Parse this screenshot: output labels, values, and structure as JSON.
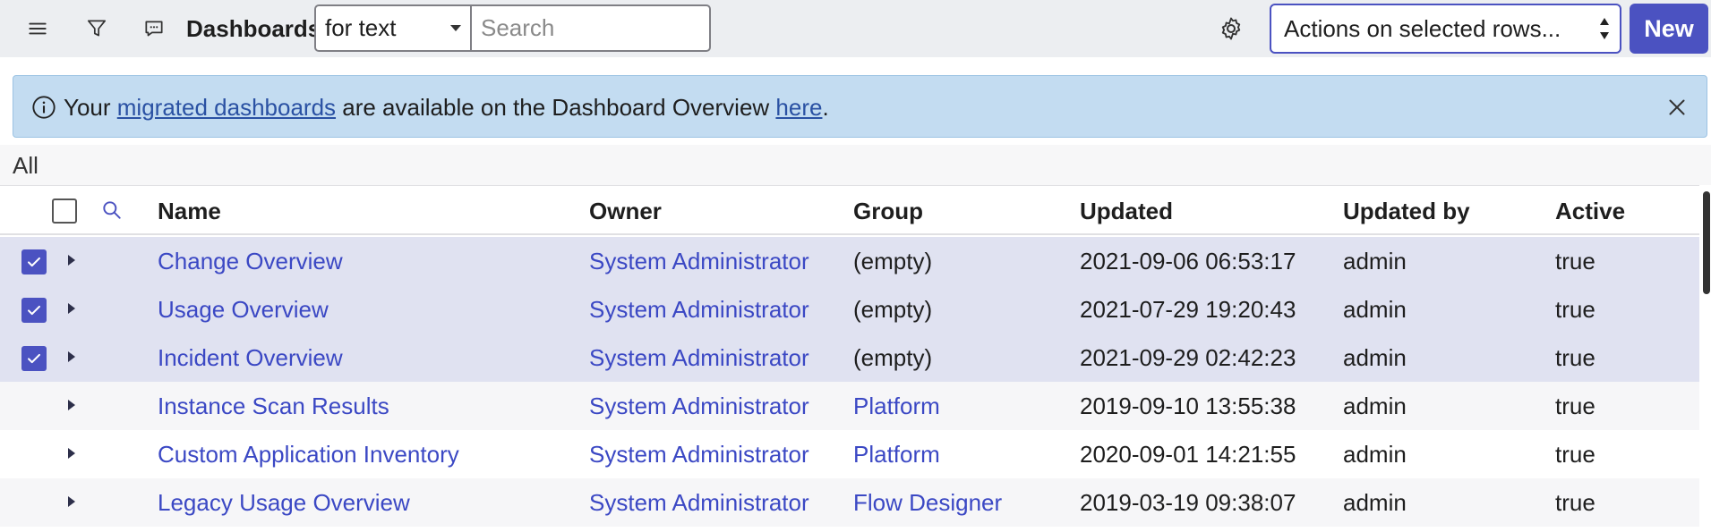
{
  "header": {
    "title": "Dashboards",
    "search_field_select": "for text",
    "search_placeholder": "Search",
    "actions_select": "Actions on selected rows...",
    "new_button": "New"
  },
  "banner": {
    "text_before": "Your ",
    "link1": "migrated dashboards",
    "text_middle": " are available on the Dashboard Overview ",
    "link2": "here",
    "text_after": "."
  },
  "breadcrumb": "All",
  "table": {
    "columns": [
      "Name",
      "Owner",
      "Group",
      "Updated",
      "Updated by",
      "Active"
    ],
    "rows": [
      {
        "selected": true,
        "name": "Change Overview",
        "owner": "System Administrator",
        "group": "(empty)",
        "group_link": false,
        "updated": "2021-09-06 06:53:17",
        "updated_by": "admin",
        "active": "true"
      },
      {
        "selected": true,
        "name": "Usage Overview",
        "owner": "System Administrator",
        "group": "(empty)",
        "group_link": false,
        "updated": "2021-07-29 19:20:43",
        "updated_by": "admin",
        "active": "true"
      },
      {
        "selected": true,
        "name": "Incident Overview",
        "owner": "System Administrator",
        "group": "(empty)",
        "group_link": false,
        "updated": "2021-09-29 02:42:23",
        "updated_by": "admin",
        "active": "true"
      },
      {
        "selected": false,
        "name": "Instance Scan Results",
        "owner": "System Administrator",
        "group": "Platform",
        "group_link": true,
        "updated": "2019-09-10 13:55:38",
        "updated_by": "admin",
        "active": "true"
      },
      {
        "selected": false,
        "name": "Custom Application Inventory",
        "owner": "System Administrator",
        "group": "Platform",
        "group_link": true,
        "updated": "2020-09-01 14:21:55",
        "updated_by": "admin",
        "active": "true"
      },
      {
        "selected": false,
        "name": "Legacy Usage Overview",
        "owner": "System Administrator",
        "group": "Flow Designer",
        "group_link": true,
        "updated": "2019-03-19 09:38:07",
        "updated_by": "admin",
        "active": "true"
      }
    ]
  },
  "colors": {
    "accent": "#4b52c1",
    "link": "#3b48c4",
    "banner_bg": "#c3dcf1",
    "selected_row_bg": "#e0e2f1"
  }
}
